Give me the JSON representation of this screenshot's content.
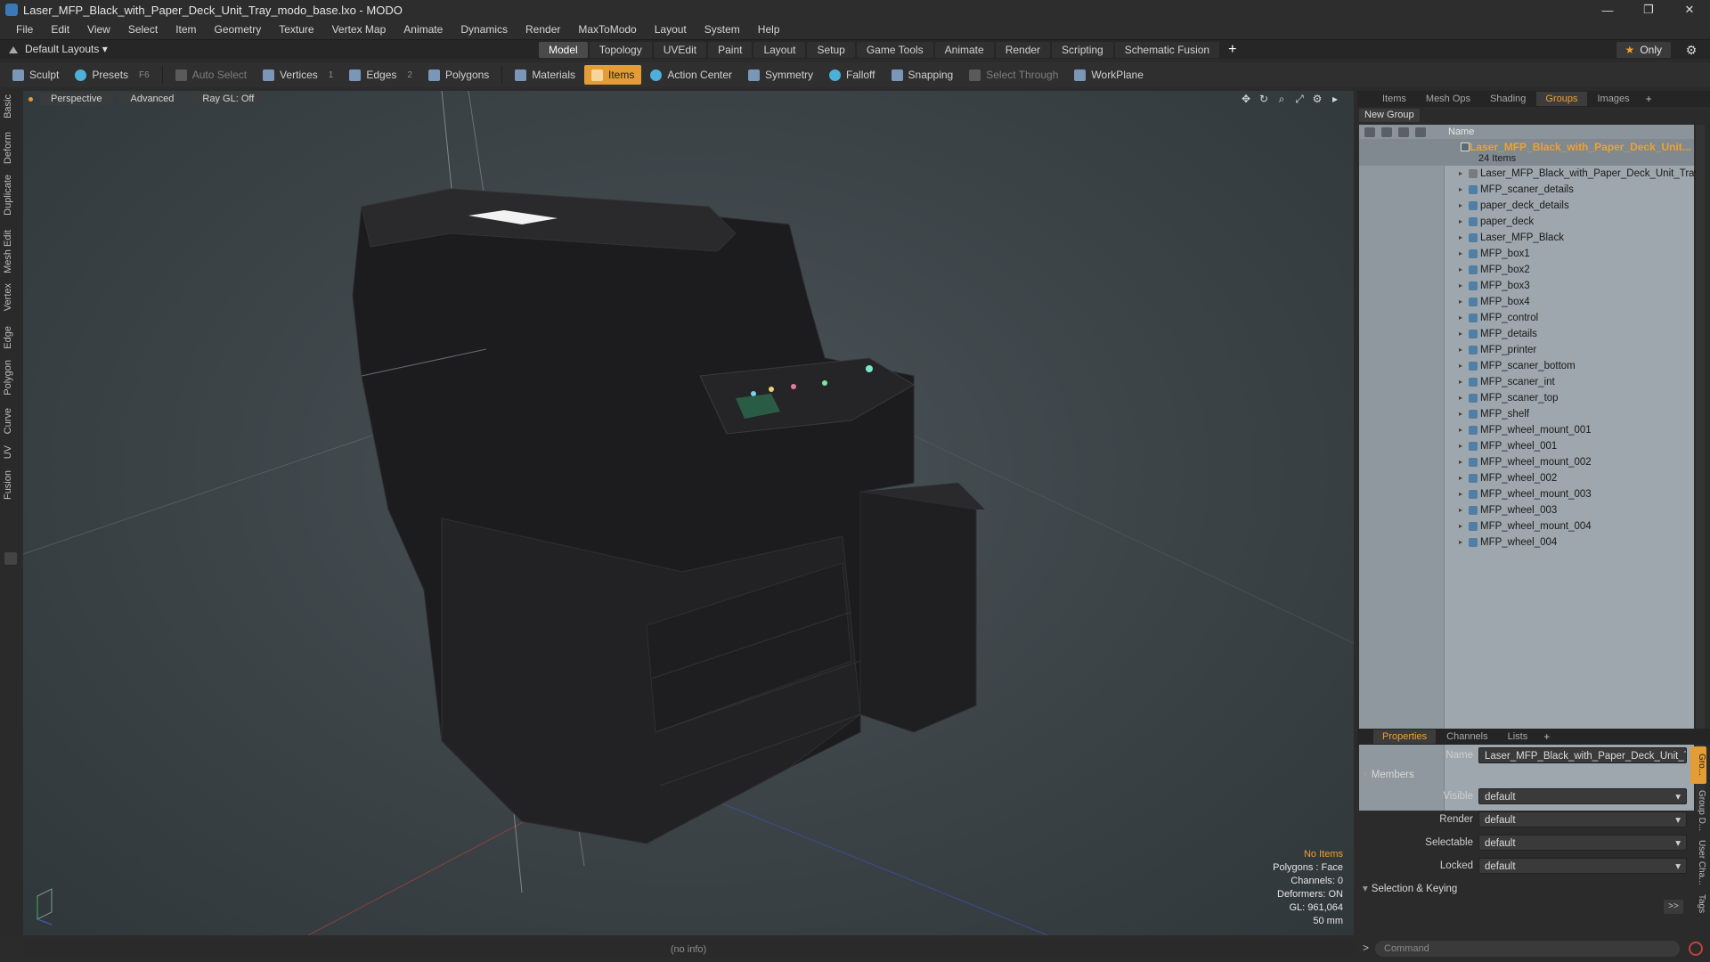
{
  "window": {
    "title": "Laser_MFP_Black_with_Paper_Deck_Unit_Tray_modo_base.lxo - MODO",
    "controls": [
      "—",
      "❐",
      "✕"
    ]
  },
  "menu": [
    "File",
    "Edit",
    "View",
    "Select",
    "Item",
    "Geometry",
    "Texture",
    "Vertex Map",
    "Animate",
    "Dynamics",
    "Render",
    "MaxToModo",
    "Layout",
    "System",
    "Help"
  ],
  "layouts": {
    "label": "Default Layouts ▾"
  },
  "tabs": [
    "Model",
    "Topology",
    "UVEdit",
    "Paint",
    "Layout",
    "Setup",
    "Game Tools",
    "Animate",
    "Render",
    "Scripting",
    "Schematic Fusion"
  ],
  "tab_add": "+",
  "only_label": "Only",
  "toolbar": {
    "sculpt": "Sculpt",
    "presets": "Presets",
    "presets_key": "F6",
    "auto_select": "Auto Select",
    "vertices": "Vertices",
    "vertices_key": "1",
    "edges": "Edges",
    "edges_key": "2",
    "polygons": "Polygons",
    "materials": "Materials",
    "items": "Items",
    "action_center": "Action Center",
    "symmetry": "Symmetry",
    "falloff": "Falloff",
    "snapping": "Snapping",
    "select_through": "Select Through",
    "workplane": "WorkPlane"
  },
  "left_tabs": [
    "Basic",
    "Deform",
    "Duplicate",
    "Mesh Edit",
    "Vertex",
    "Edge",
    "Polygon",
    "Curve",
    "UV",
    "Fusion"
  ],
  "viewport": {
    "perspective": "Perspective",
    "advanced": "Advanced",
    "raygl": "Ray GL: Off",
    "info": {
      "no_items": "No Items",
      "polygons": "Polygons : Face",
      "channels": "Channels: 0",
      "deformers": "Deformers: ON",
      "gl": "GL: 961,064",
      "scale": "50 mm"
    }
  },
  "status": "(no info)",
  "right_panel": {
    "tabs": [
      "Items",
      "Mesh Ops",
      "Shading",
      "Groups",
      "Images"
    ],
    "active_tab": "Groups",
    "new_group": "New Group",
    "name_header": "Name",
    "group_name": "Laser_MFP_Black_with_Paper_Deck_Unit...",
    "group_count": "24 Items",
    "items": [
      "Laser_MFP_Black_with_Paper_Deck_Unit_Tray",
      "MFP_scaner_details",
      "paper_deck_details",
      "paper_deck",
      "Laser_MFP_Black",
      "MFP_box1",
      "MFP_box2",
      "MFP_box3",
      "MFP_box4",
      "MFP_control",
      "MFP_details",
      "MFP_printer",
      "MFP_scaner_bottom",
      "MFP_scaner_int",
      "MFP_scaner_top",
      "MFP_shelf",
      "MFP_wheel_mount_001",
      "MFP_wheel_001",
      "MFP_wheel_mount_002",
      "MFP_wheel_002",
      "MFP_wheel_mount_003",
      "MFP_wheel_003",
      "MFP_wheel_mount_004",
      "MFP_wheel_004"
    ]
  },
  "properties": {
    "tabs": [
      "Properties",
      "Channels",
      "Lists"
    ],
    "name_label": "Name",
    "name_value": "Laser_MFP_Black_with_Paper_Deck_Unit_Tra",
    "members_label": "Members",
    "visible_label": "Visible",
    "visible_value": "default",
    "render_label": "Render",
    "render_value": "default",
    "selectable_label": "Selectable",
    "selectable_value": "default",
    "locked_label": "Locked",
    "locked_value": "default",
    "selection_keying": "Selection & Keying",
    "expand": ">>",
    "side_tabs": [
      "Gro...",
      "Group D...",
      "User Cha...",
      "Tags"
    ]
  },
  "command": {
    "placeholder": "Command",
    "prompt": ">"
  },
  "colors": {
    "accent": "#e39c36",
    "tree_bg": "#9ea7ad",
    "viewport_bg": "#3c4448"
  }
}
